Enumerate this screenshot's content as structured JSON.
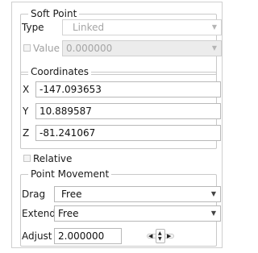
{
  "soft_point": {
    "legend": "Soft Point",
    "type_label": "Type",
    "type_value": "Linked",
    "value_label": "Value",
    "value_value": "0.000000"
  },
  "coordinates": {
    "legend": "Coordinates",
    "x_label": "X",
    "x_value": "-147.093653",
    "y_label": "Y",
    "y_value": "10.889587",
    "z_label": "Z",
    "z_value": "-81.241067"
  },
  "relative_label": "Relative",
  "point_movement": {
    "legend": "Point Movement",
    "drag_label": "Drag",
    "drag_value": "Free",
    "extend_label": "Extend",
    "extend_value": "Free",
    "adjust_label": "Adjust",
    "adjust_value": "2.000000"
  },
  "icons": {
    "dropdown": "chevron-down-icon",
    "spinner": "nudge-spinner-icon"
  }
}
